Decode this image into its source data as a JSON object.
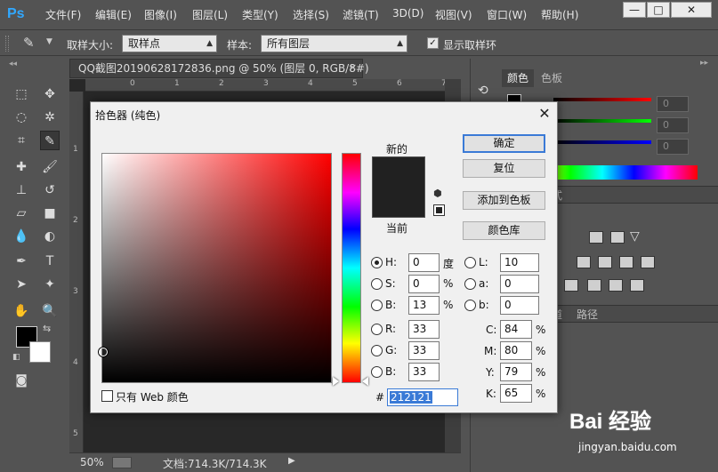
{
  "app": {
    "logo": "Ps"
  },
  "menu": [
    "文件(F)",
    "编辑(E)",
    "图像(I)",
    "图层(L)",
    "类型(Y)",
    "选择(S)",
    "滤镜(T)",
    "3D(D)",
    "视图(V)",
    "窗口(W)",
    "帮助(H)"
  ],
  "window_controls": {
    "minimize": "—",
    "maximize": "□",
    "close": "✕"
  },
  "options": {
    "sample_size_label": "取样大小:",
    "sample_size_value": "取样点",
    "sample_label": "样本:",
    "sample_value": "所有图层",
    "show_ring_label": "显示取样环",
    "show_ring_checked": true
  },
  "document": {
    "tab_title": "QQ截图20190628172836.png @ 50% (图层 0, RGB/8#)",
    "close": "×",
    "zoom": "50%",
    "doc_size": "文档:714.3K/714.3K",
    "ruler_h": [
      "0",
      "1",
      "2",
      "3",
      "4",
      "5",
      "6",
      "7",
      "8"
    ],
    "ruler_v": [
      "1",
      "2",
      "3",
      "4",
      "5"
    ]
  },
  "color_panel": {
    "tabs": [
      "颜色",
      "色板"
    ],
    "r": "0",
    "g": "0",
    "b": "0"
  },
  "lower_panels": {
    "styles_tab_fragment": "式",
    "channels_tab_fragment": "道",
    "paths_tab": "路径"
  },
  "dialog": {
    "title": "拾色器 (纯色)",
    "close": "✕",
    "new_label": "新的",
    "current_label": "当前",
    "new_color": "#212121",
    "current_color": "#212121",
    "buttons": {
      "ok": "确定",
      "reset": "复位",
      "add_to_swatches": "添加到色板",
      "color_libraries": "颜色库"
    },
    "web_only_label": "只有 Web 颜色",
    "fields": {
      "H": {
        "label": "H:",
        "value": "0",
        "unit": "度"
      },
      "S": {
        "label": "S:",
        "value": "0",
        "unit": "%"
      },
      "B": {
        "label": "B:",
        "value": "13",
        "unit": "%"
      },
      "R": {
        "label": "R:",
        "value": "33"
      },
      "G": {
        "label": "G:",
        "value": "33"
      },
      "Bl": {
        "label": "B:",
        "value": "33"
      },
      "L": {
        "label": "L:",
        "value": "10"
      },
      "a": {
        "label": "a:",
        "value": "0"
      },
      "b": {
        "label": "b:",
        "value": "0"
      },
      "C": {
        "label": "C:",
        "value": "84",
        "unit": "%"
      },
      "M": {
        "label": "M:",
        "value": "80",
        "unit": "%"
      },
      "Y": {
        "label": "Y:",
        "value": "79",
        "unit": "%"
      },
      "K": {
        "label": "K:",
        "value": "65",
        "unit": "%"
      }
    },
    "hex_label": "#",
    "hex_value": "212121"
  },
  "watermark": {
    "brand": "Bai 经验",
    "url": "jingyan.baidu.com"
  }
}
